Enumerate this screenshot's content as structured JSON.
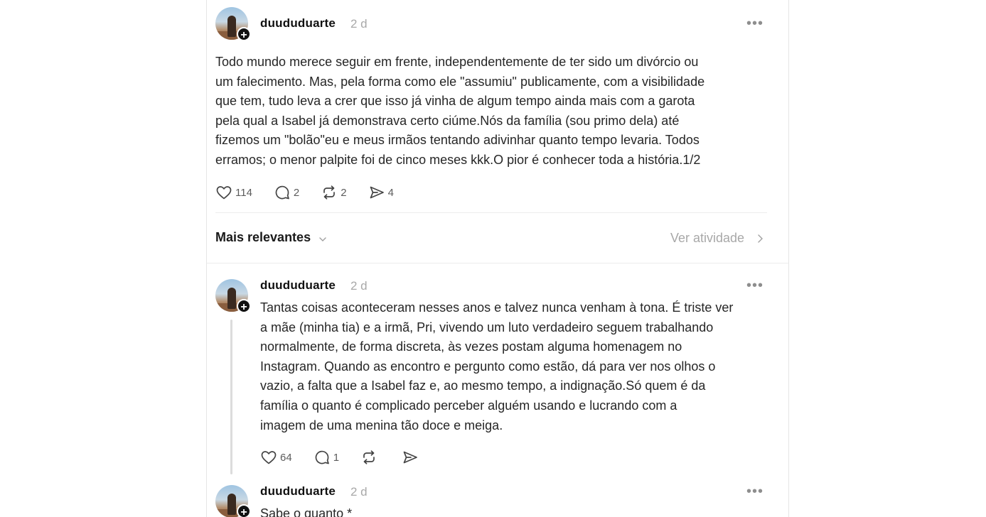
{
  "post": {
    "username": "duududuarte",
    "time": "2 d",
    "text": "Todo mundo merece seguir em frente, independentemente de ter sido um divórcio ou\num falecimento. Mas, pela forma como ele \"assumiu\" publicamente, com a visibilidade\nque tem, tudo leva a crer que isso já vinha de algum tempo ainda mais com a garota\npela qual a Isabel já demonstrava certo ciúme.Nós da família (sou primo dela) até\nfizemos um \"bolão\"eu e meus irmãos tentando adivinhar quanto tempo levaria. Todos\nerramos; o menor palpite foi de cinco meses kkk.O pior é conhecer toda a história.1/2",
    "likes": "114",
    "replies": "2",
    "reposts": "2",
    "shares": "4"
  },
  "sort": {
    "label": "Mais relevantes",
    "activity_link": "Ver atividade"
  },
  "reply1": {
    "username": "duududuarte",
    "time": "2 d",
    "text": "Tantas coisas aconteceram nesses anos e talvez nunca venham à tona. É triste ver\na mãe (minha tia) e a irmã, Pri, vivendo um luto verdadeiro seguem trabalhando\nnormalmente, de forma discreta, às vezes postam alguma homenagem no\nInstagram. Quando as encontro e pergunto como estão, dá para ver nos olhos o\nvazio, a falta que a Isabel faz e, ao mesmo tempo, a indignação.Só quem é da\nfamília o quanto é complicado perceber alguém usando e lucrando com a\nimagem de uma menina tão doce e meiga.",
    "likes": "64",
    "replies": "1"
  },
  "reply2": {
    "username": "duududuarte",
    "time": "2 d",
    "text": "Sabe o quanto *"
  },
  "icons": {
    "like": "heart-icon",
    "reply": "comment-icon",
    "repost": "repost-icon",
    "share": "send-icon",
    "more": "more-icon",
    "follow": "plus-icon"
  }
}
